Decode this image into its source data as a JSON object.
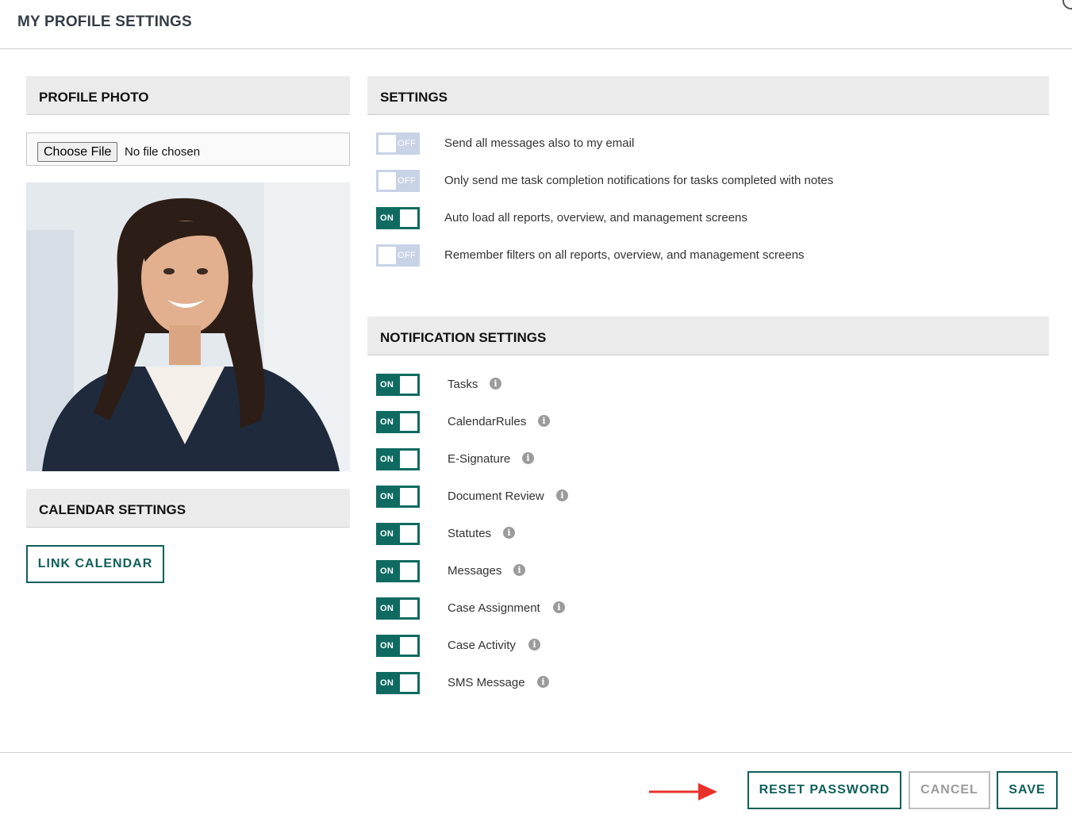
{
  "header": {
    "title": "MY PROFILE SETTINGS"
  },
  "profile_photo": {
    "heading": "PROFILE PHOTO",
    "choose_file_label": "Choose File",
    "file_status": "No file chosen"
  },
  "calendar": {
    "heading": "CALENDAR SETTINGS",
    "link_label": "LINK CALENDAR"
  },
  "settings": {
    "heading": "SETTINGS",
    "items": [
      {
        "label": "Send all messages also to my email",
        "state": "OFF"
      },
      {
        "label": "Only send me task completion notifications for tasks completed with notes",
        "state": "OFF"
      },
      {
        "label": "Auto load all reports, overview, and management screens",
        "state": "ON"
      },
      {
        "label": "Remember filters on all reports, overview, and management screens",
        "state": "OFF"
      }
    ]
  },
  "notifications": {
    "heading": "NOTIFICATION SETTINGS",
    "items": [
      {
        "label": "Tasks",
        "state": "ON"
      },
      {
        "label": "CalendarRules",
        "state": "ON"
      },
      {
        "label": "E-Signature",
        "state": "ON"
      },
      {
        "label": "Document Review",
        "state": "ON"
      },
      {
        "label": "Statutes",
        "state": "ON"
      },
      {
        "label": "Messages",
        "state": "ON"
      },
      {
        "label": "Case Assignment",
        "state": "ON"
      },
      {
        "label": "Case Activity",
        "state": "ON"
      },
      {
        "label": "SMS Message",
        "state": "ON"
      }
    ]
  },
  "footer": {
    "reset_label": "RESET PASSWORD",
    "cancel_label": "CANCEL",
    "save_label": "SAVE"
  },
  "colors": {
    "accent": "#0f6b61",
    "toggle_off": "#c9d3e6",
    "arrow": "#e8302a"
  },
  "icons": {
    "info": "info-icon",
    "arrow": "arrow-right-icon"
  }
}
